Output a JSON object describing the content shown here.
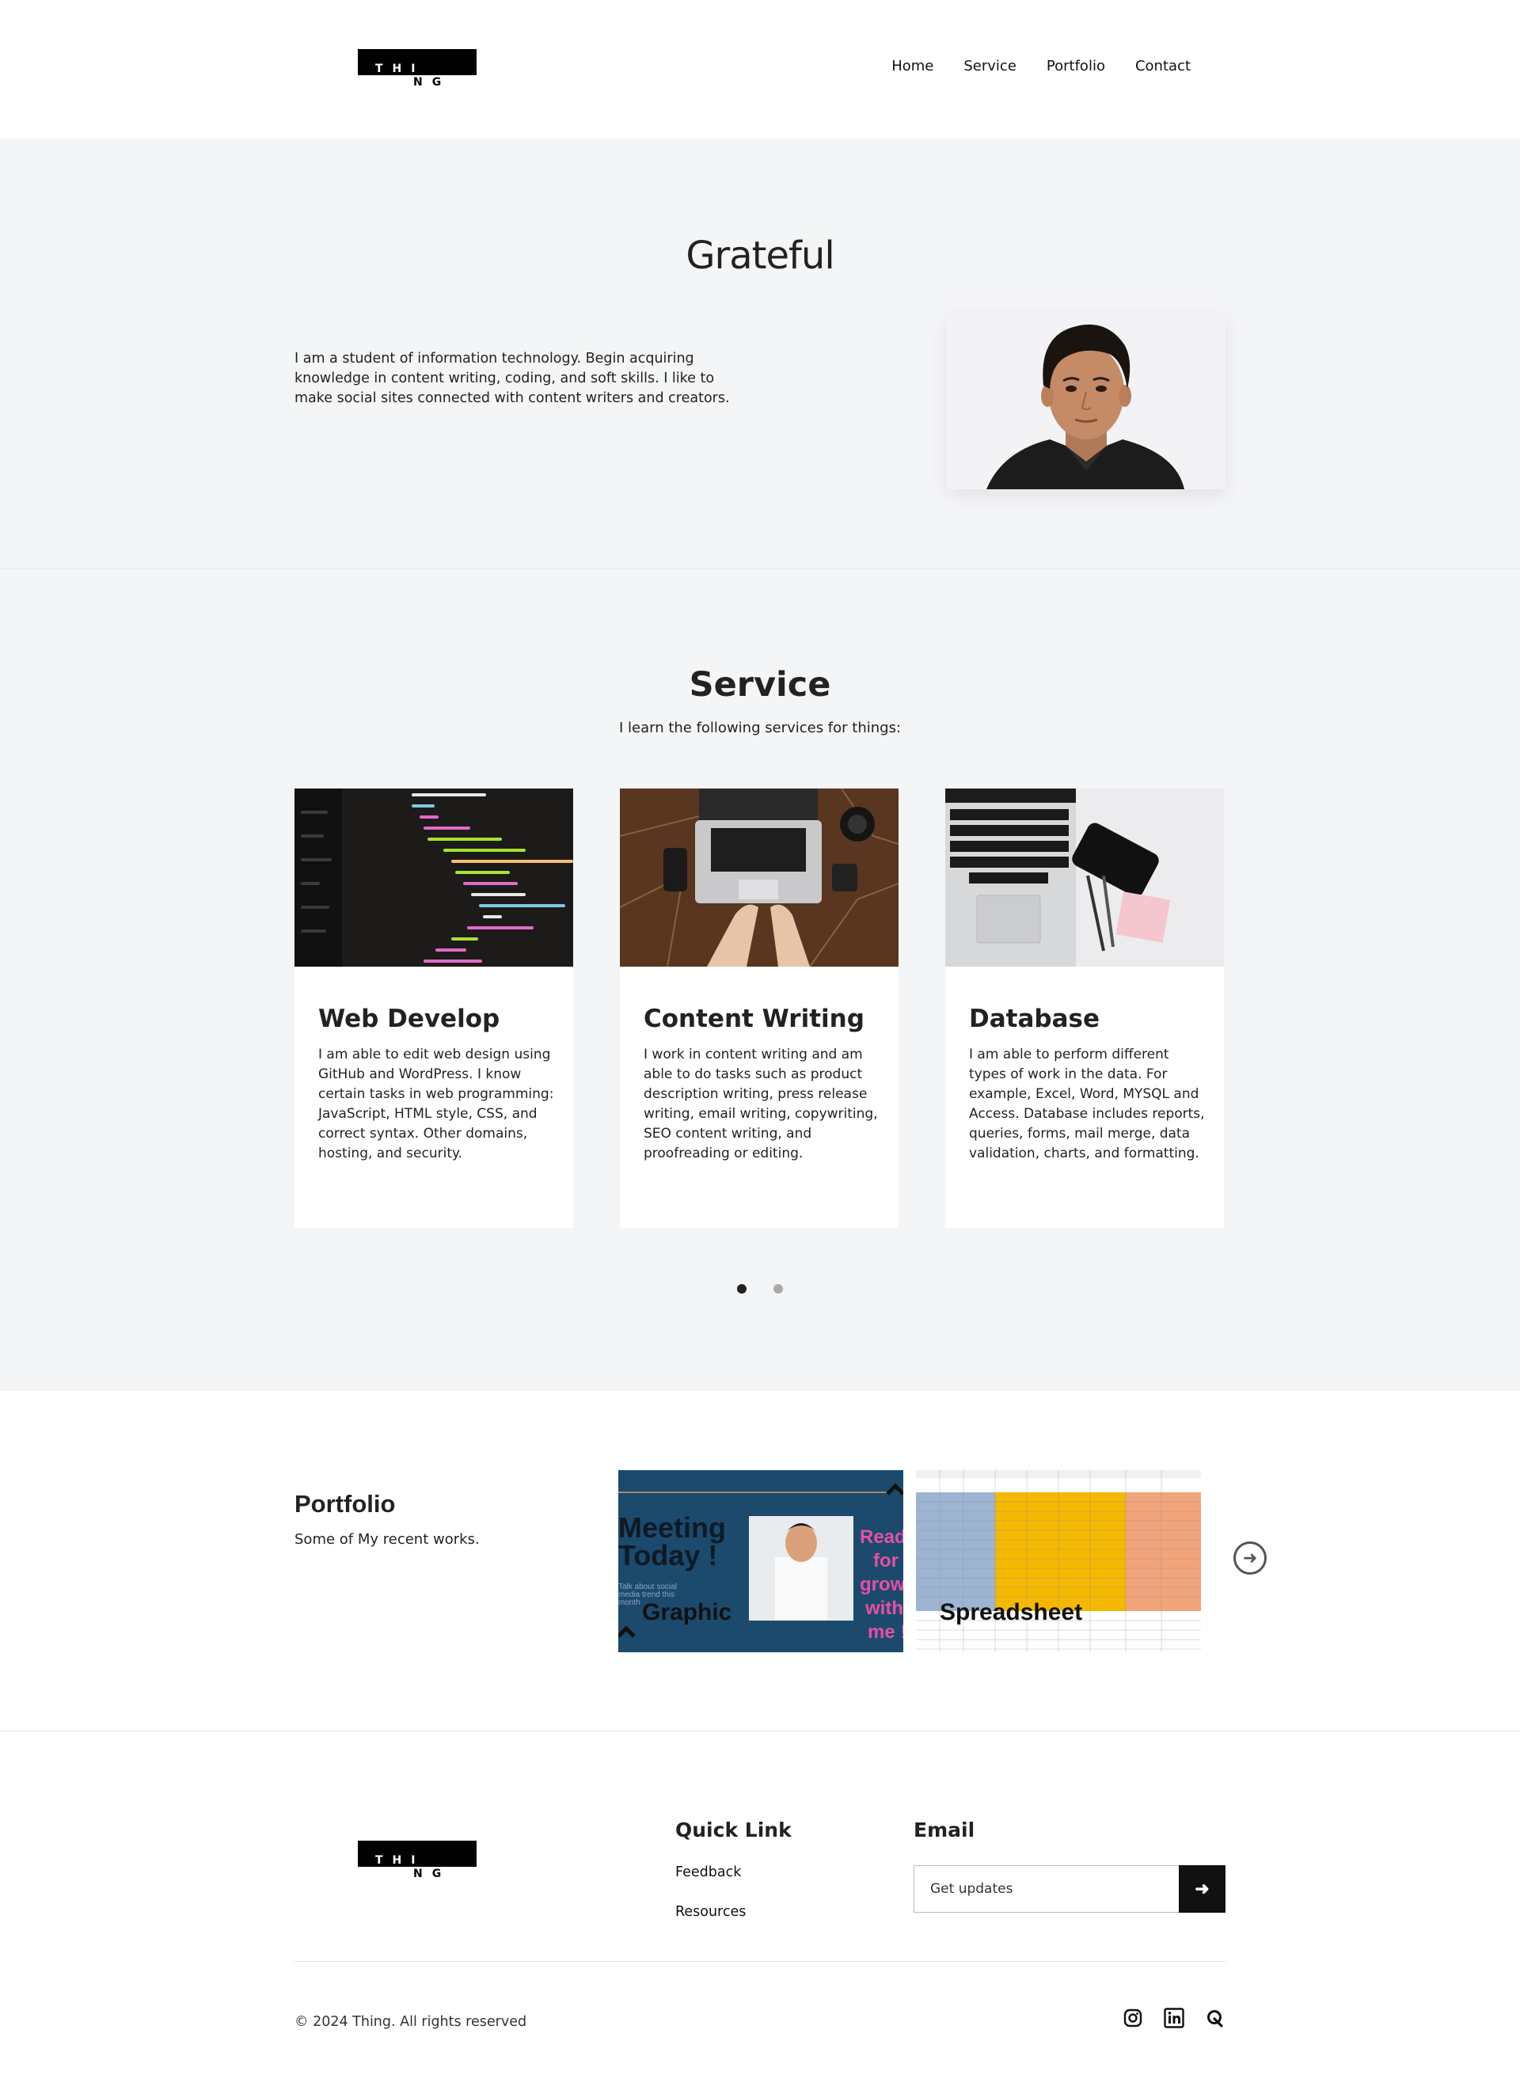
{
  "brand": {
    "logo_line1": "THI",
    "logo_line2": "NG"
  },
  "nav": {
    "items": [
      "Home",
      "Service",
      "Portfolio",
      "Contact"
    ]
  },
  "hero": {
    "title": "Grateful",
    "text": "I am a student of information technology. Begin acquiring knowledge in content writing, coding, and soft skills. I like to make social sites connected with content writers and creators."
  },
  "service": {
    "title": "Service",
    "subtitle": "I learn the following services for things:",
    "cards": [
      {
        "title": "Web Develop",
        "text": "I am able to edit web design using GitHub and WordPress. I know certain tasks in web programming: JavaScript, HTML style, CSS, and correct syntax. Other domains, hosting, and security."
      },
      {
        "title": "Content Writing",
        "text": "I work in content writing and am able to do tasks such as product description writing, press release writing, email writing, copywriting, SEO content writing, and proofreading or editing."
      },
      {
        "title": "Database",
        "text": "I am able to perform different types of work in the data. For example, Excel, Word, MYSQL and Access. Database includes reports, queries, forms, mail merge, data validation, charts, and formatting."
      }
    ],
    "slider": {
      "total": 2,
      "active": 1
    }
  },
  "portfolio": {
    "title": "Portfolio",
    "subtitle": "Some of My recent works.",
    "items": [
      {
        "label": "Graphic",
        "image_text": [
          "Meeting",
          "Today !",
          "Talk about social",
          "media trend this",
          "month",
          "Read",
          "for",
          "grow",
          "with",
          "me !"
        ]
      },
      {
        "label": "Spreadsheet"
      }
    ]
  },
  "footer": {
    "quick_link_title": "Quick Link",
    "links": [
      "Feedback",
      "Resources"
    ],
    "email_title": "Email",
    "email_placeholder": "Get updates",
    "copyright": "© 2024 Thing. All rights reserved",
    "socials": [
      "instagram-icon",
      "linkedin-icon",
      "quora-icon"
    ]
  }
}
